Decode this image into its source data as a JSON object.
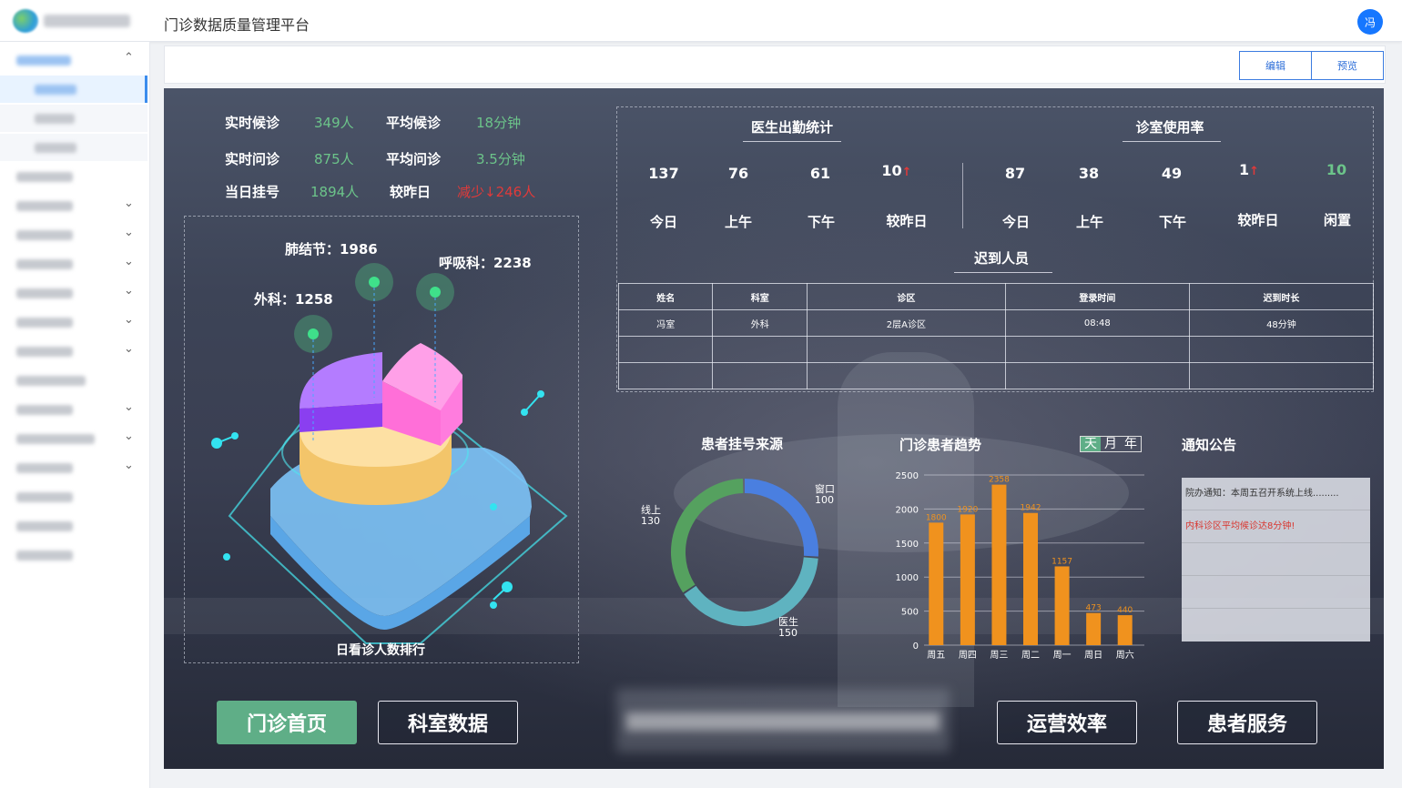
{
  "app": {
    "title": "门诊数据质量管理平台",
    "user_initial": "冯"
  },
  "toolbar": {
    "edit_label": "编辑",
    "preview_label": "预览"
  },
  "realtime": {
    "rows": [
      {
        "label1": "实时候诊",
        "value1": "349人",
        "label2": "平均候诊",
        "value2": "18分钟"
      },
      {
        "label1": "实时问诊",
        "value1": "875人",
        "label2": "平均问诊",
        "value2": "3.5分钟"
      },
      {
        "label1": "当日挂号",
        "value1": "1894人",
        "label2": "较昨日",
        "value2": "减少↓246人"
      }
    ]
  },
  "ranking": {
    "title": "日看诊人数排行",
    "labels": [
      {
        "text": "肺结节：1986"
      },
      {
        "text": "呼吸科：2238"
      },
      {
        "text": "外科：1258"
      }
    ]
  },
  "attendance": {
    "title": "医生出勤统计",
    "items": [
      {
        "value": "137",
        "label": "今日"
      },
      {
        "value": "76",
        "label": "上午"
      },
      {
        "value": "61",
        "label": "下午"
      },
      {
        "value": "10",
        "label": "较昨日",
        "arrow": "↑"
      }
    ]
  },
  "room_usage": {
    "title": "诊室使用率",
    "items": [
      {
        "value": "87",
        "label": "今日"
      },
      {
        "value": "38",
        "label": "上午"
      },
      {
        "value": "49",
        "label": "下午"
      },
      {
        "value": "1",
        "label": "较昨日",
        "arrow": "↑"
      },
      {
        "value": "10",
        "label": "闲置"
      }
    ]
  },
  "late": {
    "title": "迟到人员",
    "headers": [
      "姓名",
      "科室",
      "诊区",
      "登录时间",
      "迟到时长"
    ],
    "rows": [
      [
        "冯室",
        "外科",
        "2层A诊区",
        "08:48",
        "48分钟"
      ],
      [
        "",
        "",
        "",
        "",
        ""
      ],
      [
        "",
        "",
        "",
        "",
        ""
      ]
    ]
  },
  "source": {
    "title": "患者挂号来源"
  },
  "trend": {
    "title": "门诊患者趋势",
    "tabs": [
      "天",
      "月",
      "年"
    ]
  },
  "notice": {
    "title": "通知公告",
    "items": [
      "院办通知：本周五召开系统上线.........",
      "内科诊区平均候诊达8分钟!"
    ]
  },
  "nav": {
    "home": "门诊首页",
    "dept": "科室数据",
    "ops": "运营效率",
    "patient": "患者服务"
  },
  "chart_data": [
    {
      "type": "pie",
      "title": "患者挂号来源",
      "categories": [
        "窗口",
        "医生",
        "线上"
      ],
      "values": [
        100,
        150,
        130
      ],
      "colors": [
        "#4a7fe0",
        "#5fb3c0",
        "#55a15f"
      ]
    },
    {
      "type": "bar",
      "title": "门诊患者趋势",
      "categories": [
        "周五",
        "周四",
        "周三",
        "周二",
        "周一",
        "周日",
        "周六"
      ],
      "values": [
        1800,
        1920,
        2358,
        1942,
        1157,
        473,
        440
      ],
      "ylim": [
        0,
        2500
      ],
      "yticks": [
        0,
        500,
        1000,
        1500,
        2000,
        2500
      ],
      "color": "#f0921e"
    }
  ]
}
